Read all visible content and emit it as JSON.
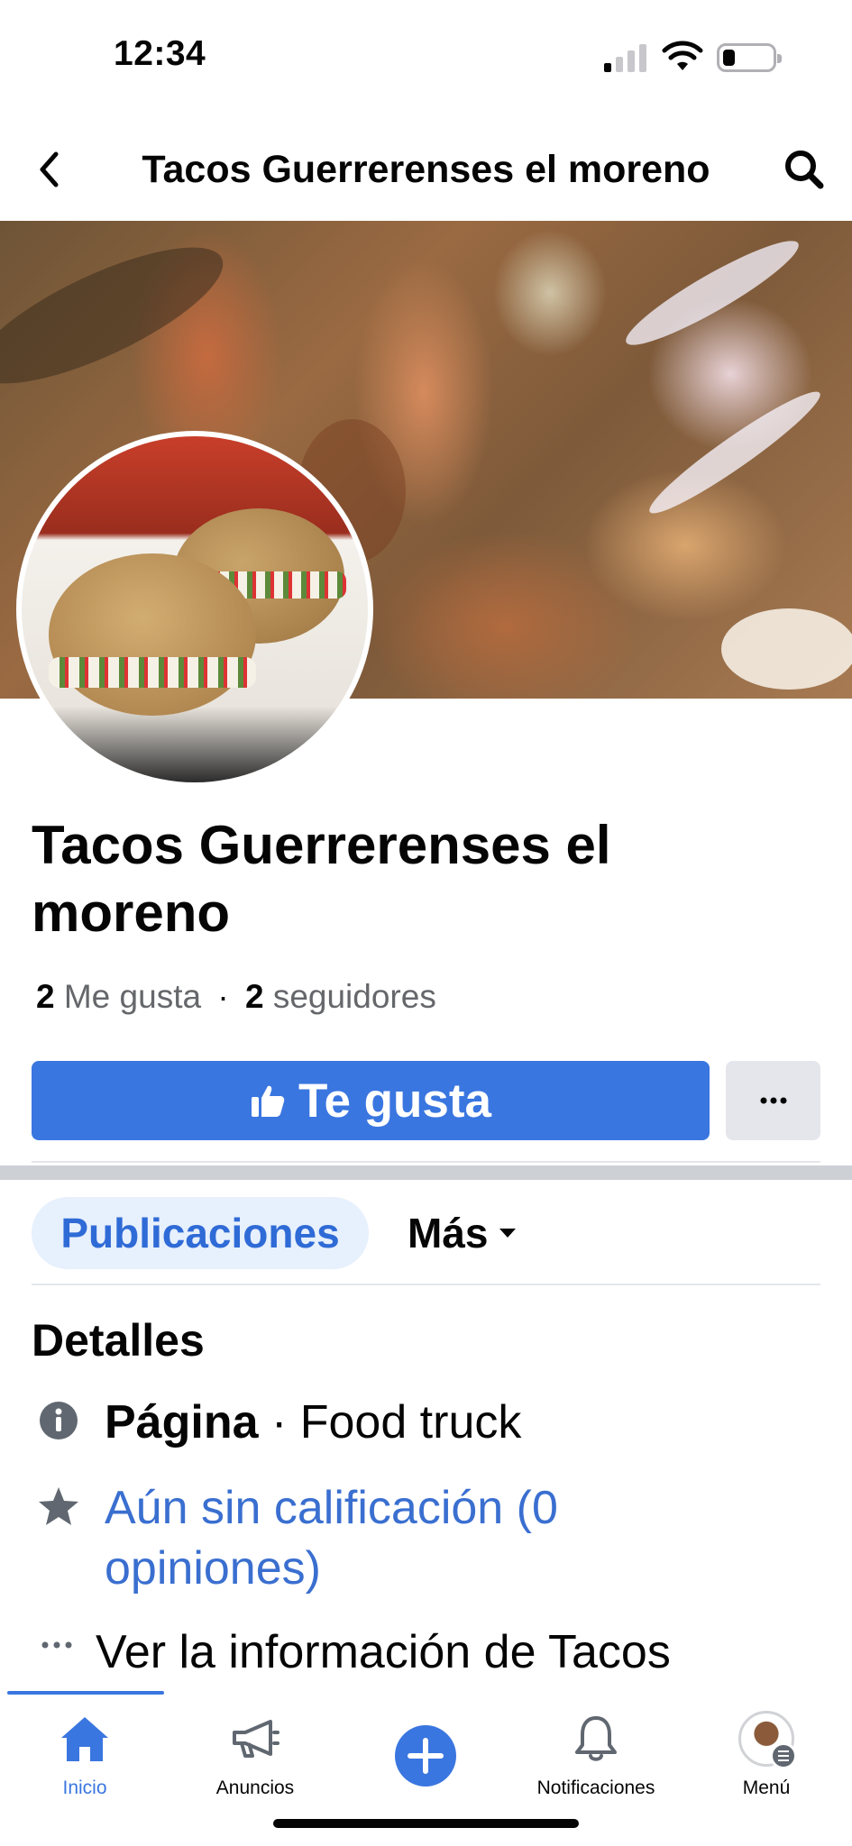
{
  "status_bar": {
    "time": "12:34"
  },
  "header": {
    "title": "Tacos Guerrerenses el moreno"
  },
  "page": {
    "name": "Tacos Guerrerenses el moreno",
    "likes_count": "2",
    "likes_label": "Me gusta",
    "separator": "·",
    "followers_count": "2",
    "followers_label": "seguidores"
  },
  "actions": {
    "like_label": "Te gusta"
  },
  "tabs": {
    "posts": "Publicaciones",
    "more": "Más"
  },
  "details": {
    "title": "Detalles",
    "category_prefix": "Página",
    "category_value": " · Food truck",
    "rating_text": "Aún sin calificación (0 opiniones)",
    "info_text": "Ver la información de Tacos"
  },
  "bottom_nav": [
    {
      "label": "Inicio",
      "icon": "home-icon",
      "active": true
    },
    {
      "label": "Anuncios",
      "icon": "megaphone-icon",
      "active": false
    },
    {
      "label": "",
      "icon": "plus-circle-icon",
      "active": false
    },
    {
      "label": "Notificaciones",
      "icon": "bell-icon",
      "active": false
    },
    {
      "label": "Menú",
      "icon": "profile-avatar",
      "active": false
    }
  ],
  "colors": {
    "accent": "#3a76e0",
    "tab_active_bg": "#e7f0fd",
    "secondary_text": "#65676b",
    "button_gray": "#e4e6eb"
  }
}
